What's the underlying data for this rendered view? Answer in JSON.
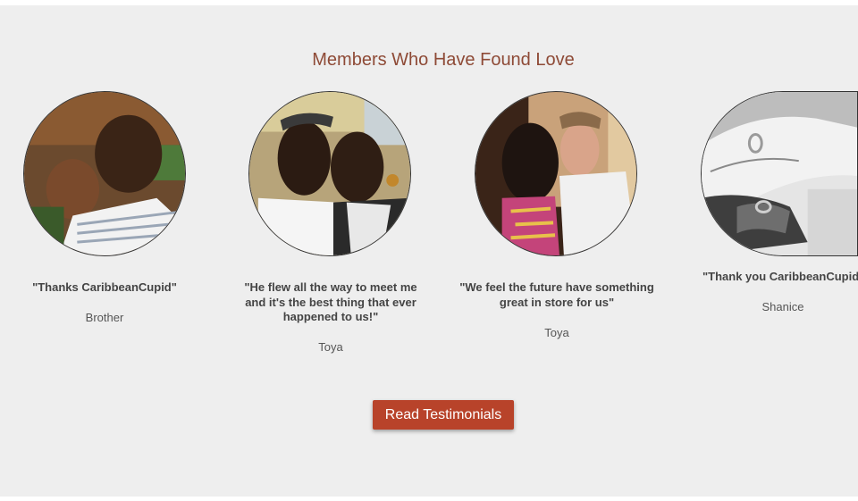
{
  "section": {
    "heading": "Members Who Have Found Love"
  },
  "testimonials": [
    {
      "quote": "\"Thanks CaribbeanCupid\"",
      "name": "Brother",
      "photo": "couple-photo-1"
    },
    {
      "quote": "\"He flew all the way to meet me and it's the best thing that ever happened to us!\"",
      "name": "Toya",
      "photo": "couple-photo-2"
    },
    {
      "quote": "\"We feel the future have something great in store for us\"",
      "name": "Toya",
      "photo": "couple-photo-3"
    },
    {
      "quote": "\"Thank you CaribbeanCupid!",
      "name": "Shanice",
      "photo": "rings-photo"
    }
  ],
  "cta": {
    "label": "Read Testimonials"
  },
  "colors": {
    "heading": "#8e4a36",
    "button": "#b8432a",
    "background": "#eeeeee"
  }
}
